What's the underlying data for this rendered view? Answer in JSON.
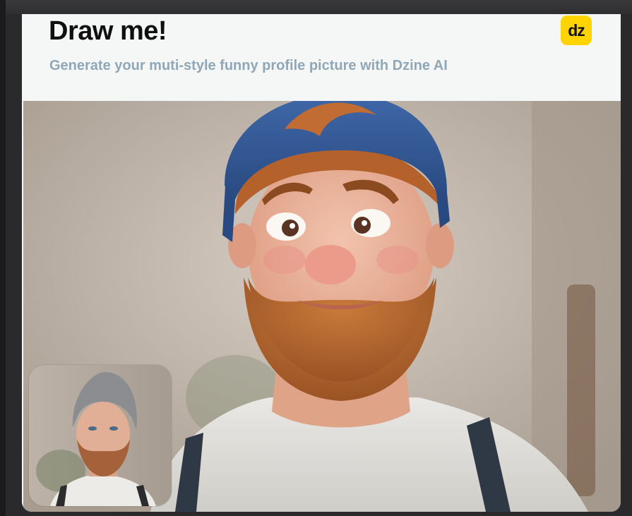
{
  "header": {
    "title": "Draw me!",
    "subtitle": "Generate your muti-style funny profile picture with Dzine AI",
    "logo_text": "dz"
  },
  "colors": {
    "accent": "#ffd400",
    "subtitle": "#8fa7b6",
    "title": "#0f0f10"
  },
  "images": {
    "hero": "cartoon-style portrait of bearded man",
    "thumbnail": "original photo of bearded man"
  }
}
